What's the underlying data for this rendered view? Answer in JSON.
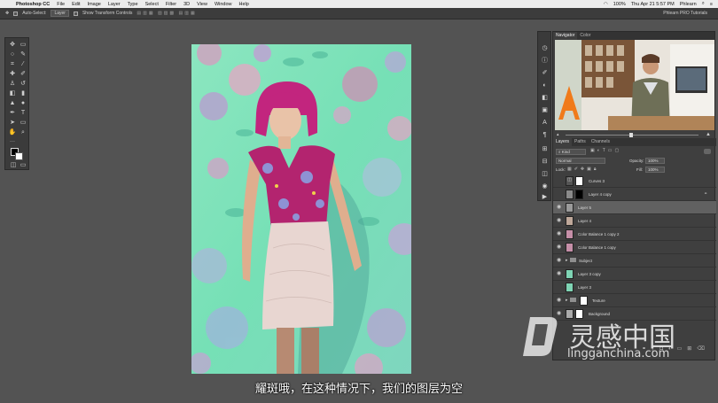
{
  "menubar": {
    "app_name": "Photoshop CC",
    "items": [
      "File",
      "Edit",
      "Image",
      "Layer",
      "Type",
      "Select",
      "Filter",
      "3D",
      "View",
      "Window",
      "Help"
    ],
    "status_percent": "100%",
    "datetime": "Thu Apr 21  5:57 PM",
    "user": "Phlearn"
  },
  "options_bar": {
    "auto_select_label": "Auto-Select:",
    "auto_select_value": "Layer",
    "transform_label": "Show Transform Controls",
    "workspace": "Phlearn PRO Tutorials"
  },
  "navigator": {
    "tabs": [
      "Navigator",
      "Color"
    ]
  },
  "layers_panel": {
    "tabs": [
      "Layers",
      "Paths",
      "Channels"
    ],
    "filter_kind": "Kind",
    "blend_mode": "Normal",
    "opacity_label": "Opacity:",
    "opacity_value": "100%",
    "lock_label": "Lock:",
    "fill_label": "Fill:",
    "fill_value": "100%",
    "layers": [
      {
        "name": "Curves 3"
      },
      {
        "name": "Layer 4 copy"
      },
      {
        "name": "Layer 5"
      },
      {
        "name": "Layer 4"
      },
      {
        "name": "Color Balance 1 copy 2"
      },
      {
        "name": "Color Balance 1 copy"
      },
      {
        "name": "Subject"
      },
      {
        "name": "Layer 3 copy"
      },
      {
        "name": "Layer 3"
      },
      {
        "name": "Texture"
      },
      {
        "name": "Background"
      }
    ]
  },
  "watermark": {
    "brand_cn": "灵感中国",
    "site": "lingganchina.com"
  },
  "subtitle": "耀斑哦，在这种情况下，我们的图层为空"
}
